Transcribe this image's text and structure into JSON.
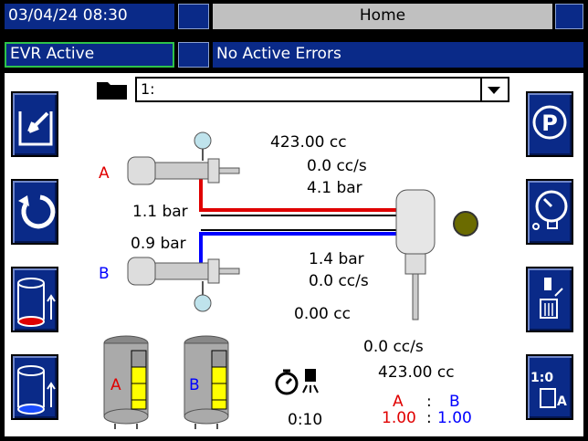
{
  "header": {
    "datetime": "03/04/24 08:30",
    "screen_title": "Home",
    "evr_status": "EVR Active",
    "error_status": "No Active Errors"
  },
  "recipe_select": {
    "value": "1:"
  },
  "pump_a": {
    "label": "A",
    "pressure": "1.1 bar"
  },
  "pump_b": {
    "label": "B",
    "pressure": "0.9 bar"
  },
  "top_readings": {
    "volume": "423.00 cc",
    "flow": "0.0 cc/s",
    "pressure": "4.1 bar"
  },
  "bottom_readings": {
    "pressure": "1.4 bar",
    "flow": "0.0 cc/s",
    "volume": "0.00 cc"
  },
  "tanks": [
    {
      "label": "A"
    },
    {
      "label": "B"
    }
  ],
  "timer": {
    "value": "0:10"
  },
  "totals": {
    "flow": "0.0  cc/s",
    "volume": "423.00  cc"
  },
  "ratio": {
    "a_label": "A",
    "b_label": "B",
    "sep_label": ":",
    "sep_value": ":",
    "a_value": "1.00",
    "b_value": "1.00"
  },
  "icons": {
    "left": [
      "edit-recipe-icon",
      "recycle-icon",
      "fill-tank-a-icon",
      "fill-tank-b-icon"
    ],
    "right": [
      "park-icon",
      "pressure-check-icon",
      "purge-icon",
      "ratio-check-icon"
    ]
  },
  "colors": {
    "a": "#ff0000",
    "b": "#0000ff",
    "accent": "#0a2a88",
    "indicator": "#6b6b00"
  }
}
